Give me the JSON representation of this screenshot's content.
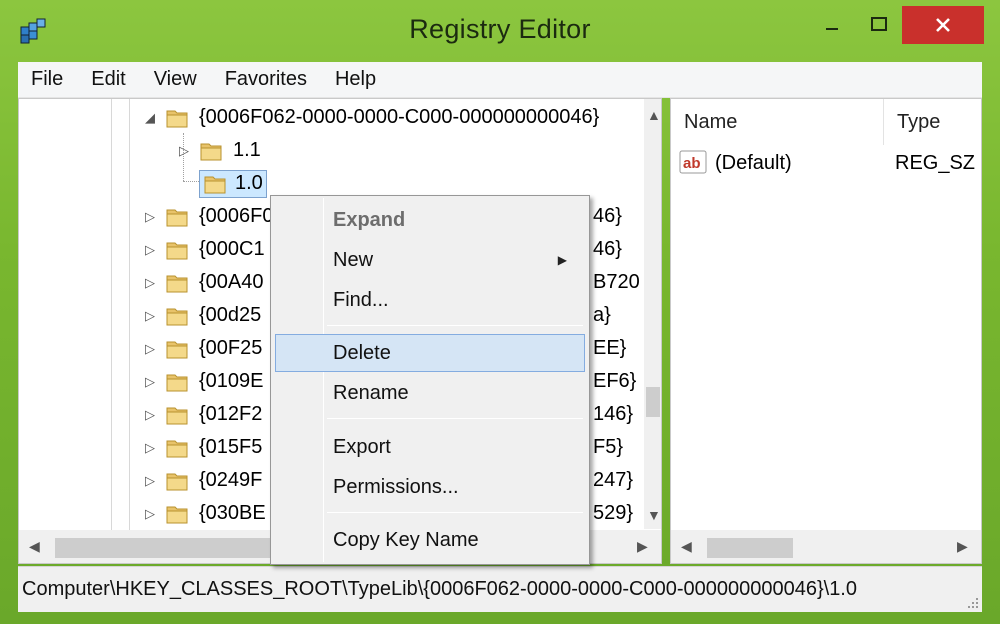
{
  "window": {
    "title": "Registry Editor"
  },
  "colors": {
    "title_bar": "#7fbf3a",
    "close_button": "#c9302c",
    "selection": "#cce8ff",
    "menu_hover": "#d5e5f5"
  },
  "menubar": {
    "items": [
      {
        "label": "File"
      },
      {
        "label": "Edit"
      },
      {
        "label": "View"
      },
      {
        "label": "Favorites"
      },
      {
        "label": "Help"
      }
    ]
  },
  "tree": {
    "parent": {
      "label": "{0006F062-0000-0000-C000-000000000046}",
      "expander": "expanded"
    },
    "children": [
      {
        "label": "1.1",
        "expander": "collapsed"
      },
      {
        "label": "1.0",
        "selected": true
      }
    ],
    "siblings": [
      {
        "label_left": "{0006F0",
        "label_right": "46}"
      },
      {
        "label_left": "{000C1",
        "label_right": "46}"
      },
      {
        "label_left": "{00A40",
        "label_right": "B720"
      },
      {
        "label_left": "{00d25",
        "label_right": "a}"
      },
      {
        "label_left": "{00F25",
        "label_right": "EE}"
      },
      {
        "label_left": "{0109E",
        "label_right": "EF6}"
      },
      {
        "label_left": "{012F2",
        "label_right": "146}"
      },
      {
        "label_left": "{015F5",
        "label_right": "F5}"
      },
      {
        "label_left": "{0249F",
        "label_right": "247}"
      },
      {
        "label_left": "{030BE",
        "label_right": "529}"
      }
    ]
  },
  "values_pane": {
    "columns": {
      "name": "Name",
      "type": "Type"
    },
    "rows": [
      {
        "icon": "string-value-icon",
        "name": "(Default)",
        "type": "REG_SZ"
      }
    ]
  },
  "context_menu": {
    "expand": "Expand",
    "new": "New",
    "find": "Find...",
    "delete": "Delete",
    "rename": "Rename",
    "export": "Export",
    "permissions": "Permissions...",
    "copy_key_name": "Copy Key Name"
  },
  "statusbar": {
    "path": "Computer\\HKEY_CLASSES_ROOT\\TypeLib\\{0006F062-0000-0000-C000-000000000046}\\1.0"
  }
}
